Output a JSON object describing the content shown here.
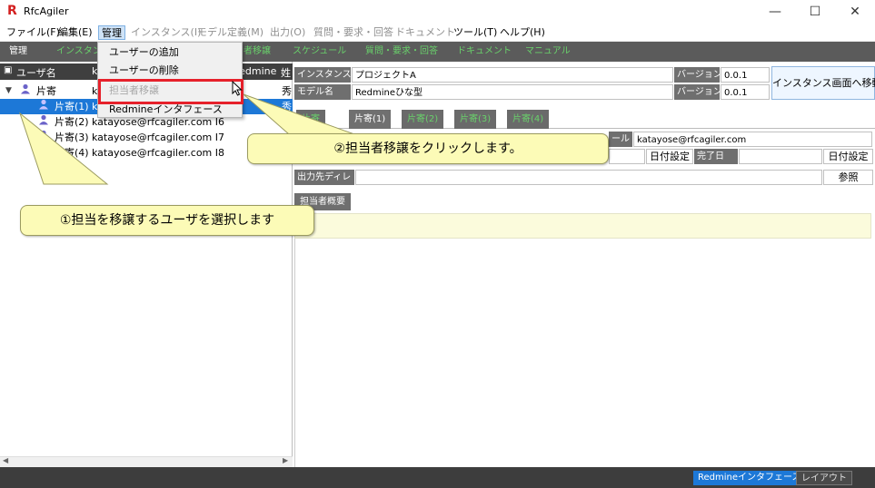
{
  "window": {
    "title": "RfcAgiler",
    "logo": "R",
    "minimize": "—",
    "maximize": "☐",
    "close": "✕"
  },
  "menubar": {
    "items": [
      {
        "label": "ファイル(F)"
      },
      {
        "label": "編集(E)"
      },
      {
        "label": "管理"
      },
      {
        "label": "インスタンス(I)"
      },
      {
        "label": "モデル定義(M)"
      },
      {
        "label": "出力(O)"
      },
      {
        "label": "質問・要求・回答"
      },
      {
        "label": "ドキュメント"
      },
      {
        "label": "ツール(T)"
      },
      {
        "label": "ヘルプ(H)"
      }
    ]
  },
  "toolbar": {
    "items": [
      {
        "label": "管理"
      },
      {
        "label": "インスタンス"
      },
      {
        "label": "者移譲"
      },
      {
        "label": "スケジュール"
      },
      {
        "label": "質問・要求・回答"
      },
      {
        "label": "ドキュメント"
      },
      {
        "label": "マニュアル"
      }
    ]
  },
  "dropdown": {
    "items": [
      {
        "label": "ユーザーの追加",
        "enabled": true
      },
      {
        "label": "ユーザーの削除",
        "enabled": true
      },
      {
        "label": "担当者移譲",
        "enabled": false
      },
      {
        "label": "Redmineインタフェース",
        "enabled": true
      }
    ],
    "highlight_color": "#e6212b"
  },
  "tree": {
    "header": {
      "col_user": "ユーザ名",
      "col_mid": "k",
      "col_redmine": "Redmine",
      "col_extra": "姓"
    },
    "rows": [
      {
        "name": "片寄",
        "rest": "k",
        "suffix": "秀",
        "level": 0,
        "expanded": true
      },
      {
        "name": "片寄(1)",
        "rest": "k",
        "suffix": "秀",
        "level": 1,
        "selected": true
      },
      {
        "name": "片寄(2)",
        "rest": "katayose@rfcagiler.com I6",
        "suffix": "",
        "level": 1
      },
      {
        "name": "片寄(3)",
        "rest": "katayose@rfcagiler.com I7",
        "suffix": "",
        "level": 1
      },
      {
        "name": "片寄(4)",
        "rest": "katayose@rfcagiler.com I8",
        "suffix": "",
        "level": 1
      }
    ],
    "user_icon_color": "#6b63c9"
  },
  "detail": {
    "instance_label": "インスタンス名",
    "instance_value": "プロジェクトA",
    "model_label": "モデル名",
    "model_value": "Redmineひな型",
    "version_label": "バージョン",
    "version_value_1": "0.0.1",
    "version_value_2": "0.0.1",
    "move_button": "インスタンス画面へ移動",
    "tabs": [
      {
        "label": "片寄"
      },
      {
        "label": "片寄(1)"
      },
      {
        "label": "片寄(2)"
      },
      {
        "label": "片寄(3)"
      },
      {
        "label": "片寄(4)"
      }
    ],
    "mail_label": "ール",
    "mail_value": "katayose@rfcagiler.com",
    "date_set_1": "日付設定",
    "end_date_label": "完了日",
    "date_set_2": "日付設定",
    "output_dir_label": "出力先ディレ",
    "browse_button": "参照",
    "summary_tab": "担当者概要"
  },
  "statusbar": {
    "redmine_button": "Redmineインタフェース",
    "layout_button": "レイアウト"
  },
  "callouts": {
    "step1": "①担当を移譲するユーザを選択します",
    "step2": "②担当者移譲をクリックします。"
  },
  "colors": {
    "selection": "#1d78d7",
    "toolbar_text": "#69d16b",
    "callout_fill": "#fcfbb7"
  }
}
